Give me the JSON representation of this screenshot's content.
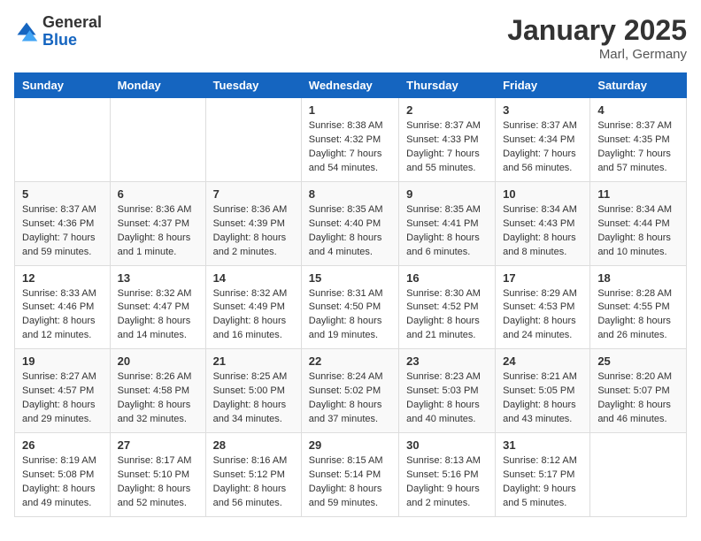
{
  "logo": {
    "general": "General",
    "blue": "Blue"
  },
  "title": "January 2025",
  "location": "Marl, Germany",
  "days_header": [
    "Sunday",
    "Monday",
    "Tuesday",
    "Wednesday",
    "Thursday",
    "Friday",
    "Saturday"
  ],
  "weeks": [
    [
      {
        "day": "",
        "content": ""
      },
      {
        "day": "",
        "content": ""
      },
      {
        "day": "",
        "content": ""
      },
      {
        "day": "1",
        "content": "Sunrise: 8:38 AM\nSunset: 4:32 PM\nDaylight: 7 hours\nand 54 minutes."
      },
      {
        "day": "2",
        "content": "Sunrise: 8:37 AM\nSunset: 4:33 PM\nDaylight: 7 hours\nand 55 minutes."
      },
      {
        "day": "3",
        "content": "Sunrise: 8:37 AM\nSunset: 4:34 PM\nDaylight: 7 hours\nand 56 minutes."
      },
      {
        "day": "4",
        "content": "Sunrise: 8:37 AM\nSunset: 4:35 PM\nDaylight: 7 hours\nand 57 minutes."
      }
    ],
    [
      {
        "day": "5",
        "content": "Sunrise: 8:37 AM\nSunset: 4:36 PM\nDaylight: 7 hours\nand 59 minutes."
      },
      {
        "day": "6",
        "content": "Sunrise: 8:36 AM\nSunset: 4:37 PM\nDaylight: 8 hours\nand 1 minute."
      },
      {
        "day": "7",
        "content": "Sunrise: 8:36 AM\nSunset: 4:39 PM\nDaylight: 8 hours\nand 2 minutes."
      },
      {
        "day": "8",
        "content": "Sunrise: 8:35 AM\nSunset: 4:40 PM\nDaylight: 8 hours\nand 4 minutes."
      },
      {
        "day": "9",
        "content": "Sunrise: 8:35 AM\nSunset: 4:41 PM\nDaylight: 8 hours\nand 6 minutes."
      },
      {
        "day": "10",
        "content": "Sunrise: 8:34 AM\nSunset: 4:43 PM\nDaylight: 8 hours\nand 8 minutes."
      },
      {
        "day": "11",
        "content": "Sunrise: 8:34 AM\nSunset: 4:44 PM\nDaylight: 8 hours\nand 10 minutes."
      }
    ],
    [
      {
        "day": "12",
        "content": "Sunrise: 8:33 AM\nSunset: 4:46 PM\nDaylight: 8 hours\nand 12 minutes."
      },
      {
        "day": "13",
        "content": "Sunrise: 8:32 AM\nSunset: 4:47 PM\nDaylight: 8 hours\nand 14 minutes."
      },
      {
        "day": "14",
        "content": "Sunrise: 8:32 AM\nSunset: 4:49 PM\nDaylight: 8 hours\nand 16 minutes."
      },
      {
        "day": "15",
        "content": "Sunrise: 8:31 AM\nSunset: 4:50 PM\nDaylight: 8 hours\nand 19 minutes."
      },
      {
        "day": "16",
        "content": "Sunrise: 8:30 AM\nSunset: 4:52 PM\nDaylight: 8 hours\nand 21 minutes."
      },
      {
        "day": "17",
        "content": "Sunrise: 8:29 AM\nSunset: 4:53 PM\nDaylight: 8 hours\nand 24 minutes."
      },
      {
        "day": "18",
        "content": "Sunrise: 8:28 AM\nSunset: 4:55 PM\nDaylight: 8 hours\nand 26 minutes."
      }
    ],
    [
      {
        "day": "19",
        "content": "Sunrise: 8:27 AM\nSunset: 4:57 PM\nDaylight: 8 hours\nand 29 minutes."
      },
      {
        "day": "20",
        "content": "Sunrise: 8:26 AM\nSunset: 4:58 PM\nDaylight: 8 hours\nand 32 minutes."
      },
      {
        "day": "21",
        "content": "Sunrise: 8:25 AM\nSunset: 5:00 PM\nDaylight: 8 hours\nand 34 minutes."
      },
      {
        "day": "22",
        "content": "Sunrise: 8:24 AM\nSunset: 5:02 PM\nDaylight: 8 hours\nand 37 minutes."
      },
      {
        "day": "23",
        "content": "Sunrise: 8:23 AM\nSunset: 5:03 PM\nDaylight: 8 hours\nand 40 minutes."
      },
      {
        "day": "24",
        "content": "Sunrise: 8:21 AM\nSunset: 5:05 PM\nDaylight: 8 hours\nand 43 minutes."
      },
      {
        "day": "25",
        "content": "Sunrise: 8:20 AM\nSunset: 5:07 PM\nDaylight: 8 hours\nand 46 minutes."
      }
    ],
    [
      {
        "day": "26",
        "content": "Sunrise: 8:19 AM\nSunset: 5:08 PM\nDaylight: 8 hours\nand 49 minutes."
      },
      {
        "day": "27",
        "content": "Sunrise: 8:17 AM\nSunset: 5:10 PM\nDaylight: 8 hours\nand 52 minutes."
      },
      {
        "day": "28",
        "content": "Sunrise: 8:16 AM\nSunset: 5:12 PM\nDaylight: 8 hours\nand 56 minutes."
      },
      {
        "day": "29",
        "content": "Sunrise: 8:15 AM\nSunset: 5:14 PM\nDaylight: 8 hours\nand 59 minutes."
      },
      {
        "day": "30",
        "content": "Sunrise: 8:13 AM\nSunset: 5:16 PM\nDaylight: 9 hours\nand 2 minutes."
      },
      {
        "day": "31",
        "content": "Sunrise: 8:12 AM\nSunset: 5:17 PM\nDaylight: 9 hours\nand 5 minutes."
      },
      {
        "day": "",
        "content": ""
      }
    ]
  ]
}
